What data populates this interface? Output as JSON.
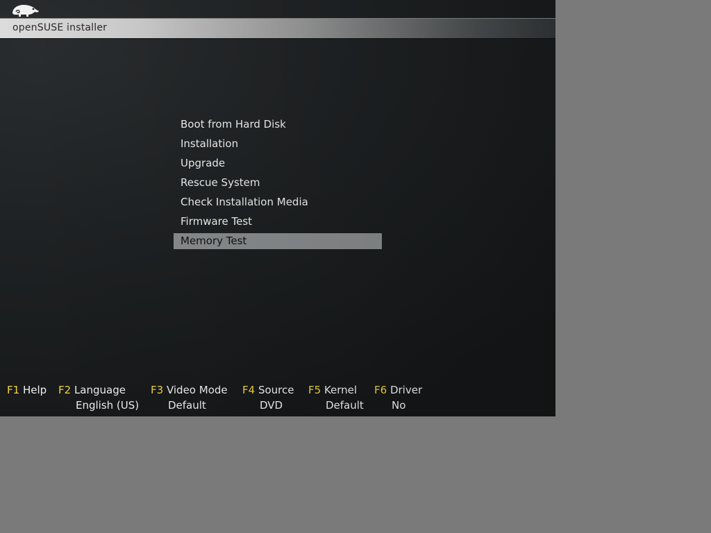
{
  "window": {
    "title": "openSUSE installer"
  },
  "menu": {
    "items": [
      {
        "label": "Boot from Hard Disk",
        "selected": false
      },
      {
        "label": "Installation",
        "selected": false
      },
      {
        "label": "Upgrade",
        "selected": false
      },
      {
        "label": "Rescue System",
        "selected": false
      },
      {
        "label": "Check Installation Media",
        "selected": false
      },
      {
        "label": "Firmware Test",
        "selected": false
      },
      {
        "label": "Memory Test",
        "selected": true
      }
    ]
  },
  "footer": {
    "keys": [
      {
        "key": "F1",
        "label": "Help",
        "value": ""
      },
      {
        "key": "F2",
        "label": "Language",
        "value": "English (US)"
      },
      {
        "key": "F3",
        "label": "Video Mode",
        "value": "Default"
      },
      {
        "key": "F4",
        "label": "Source",
        "value": "DVD"
      },
      {
        "key": "F5",
        "label": "Kernel",
        "value": "Default"
      },
      {
        "key": "F6",
        "label": "Driver",
        "value": "No"
      }
    ]
  },
  "colors": {
    "fkey_accent": "#f5d73b",
    "selection_bg": "#8a8d8f",
    "text": "#f2f2f2"
  },
  "icons": {
    "logo": "opensuse-chameleon-logo-icon"
  }
}
